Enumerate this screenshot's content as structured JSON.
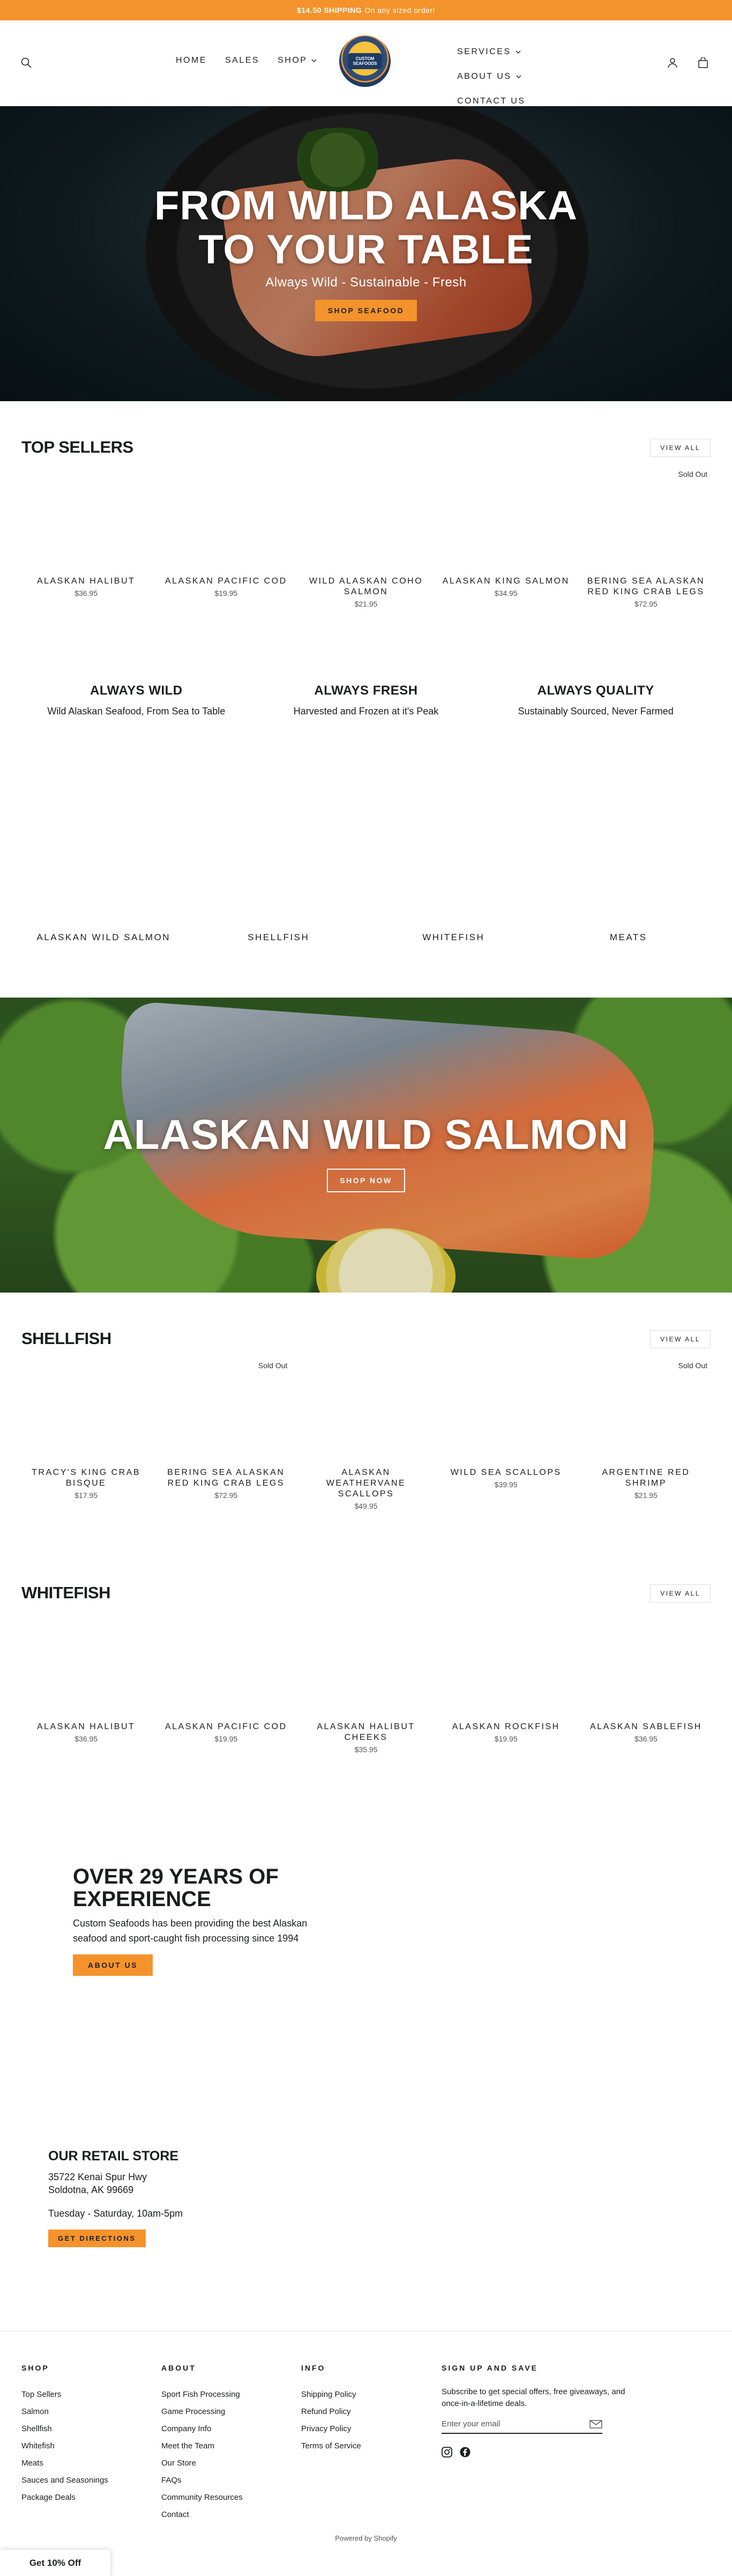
{
  "announcement": {
    "bold": "$14.50 SHIPPING",
    "rest": "On any sized order!"
  },
  "header": {
    "logo_text": "CUSTOM SEAFOODS",
    "nav_left": [
      {
        "label": "HOME"
      },
      {
        "label": "SALES"
      },
      {
        "label": "SHOP",
        "chevron": true
      }
    ],
    "nav_right": [
      {
        "label": "SERVICES",
        "chevron": true
      },
      {
        "label": "ABOUT US",
        "chevron": true
      },
      {
        "label": "CONTACT US"
      }
    ]
  },
  "hero": {
    "title": "FROM WILD ALASKA\nTO YOUR TABLE",
    "subtitle": "Always Wild - Sustainable - Fresh",
    "button": "SHOP SEAFOOD"
  },
  "top_sellers": {
    "title": "TOP SELLERS",
    "view_all": "VIEW ALL",
    "products": [
      {
        "name": "ALASKAN HALIBUT",
        "price": "$36.95",
        "sold_out": ""
      },
      {
        "name": "ALASKAN PACIFIC COD",
        "price": "$19.95",
        "sold_out": ""
      },
      {
        "name": "WILD ALASKAN COHO SALMON",
        "price": "$21.95",
        "sold_out": ""
      },
      {
        "name": "ALASKAN KING SALMON",
        "price": "$34.95",
        "sold_out": ""
      },
      {
        "name": "BERING SEA ALASKAN RED KING CRAB LEGS",
        "price": "$72.95",
        "sold_out": "Sold Out"
      }
    ]
  },
  "pillars": [
    {
      "title": "ALWAYS WILD",
      "text": "Wild Alaskan Seafood, From Sea to Table"
    },
    {
      "title": "ALWAYS FRESH",
      "text": "Harvested and Frozen at it's Peak"
    },
    {
      "title": "ALWAYS QUALITY",
      "text": "Sustainably Sourced, Never Farmed"
    }
  ],
  "categories": [
    {
      "label": "ALASKAN WILD SALMON"
    },
    {
      "label": "SHELLFISH"
    },
    {
      "label": "WHITEFISH"
    },
    {
      "label": "MEATS"
    }
  ],
  "banner": {
    "title": "ALASKAN WILD SALMON",
    "button": "SHOP NOW"
  },
  "shellfish": {
    "title": "SHELLFISH",
    "view_all": "VIEW ALL",
    "products": [
      {
        "name": "TRACY'S KING CRAB BISQUE",
        "price": "$17.95",
        "sold_out": ""
      },
      {
        "name": "BERING SEA ALASKAN RED KING CRAB LEGS",
        "price": "$72.95",
        "sold_out": "Sold Out"
      },
      {
        "name": "ALASKAN WEATHERVANE SCALLOPS",
        "price": "$49.95",
        "sold_out": ""
      },
      {
        "name": "WILD SEA SCALLOPS",
        "price": "$39.95",
        "sold_out": ""
      },
      {
        "name": "ARGENTINE RED SHRIMP",
        "price": "$21.95",
        "sold_out": "Sold Out"
      }
    ]
  },
  "whitefish": {
    "title": "WHITEFISH",
    "view_all": "VIEW ALL",
    "products": [
      {
        "name": "ALASKAN HALIBUT",
        "price": "$36.95",
        "sold_out": ""
      },
      {
        "name": "ALASKAN PACIFIC COD",
        "price": "$19.95",
        "sold_out": ""
      },
      {
        "name": "ALASKAN HALIBUT CHEEKS",
        "price": "$35.95",
        "sold_out": ""
      },
      {
        "name": "ALASKAN ROCKFISH",
        "price": "$19.95",
        "sold_out": ""
      },
      {
        "name": "ALASKAN SABLEFISH",
        "price": "$36.95",
        "sold_out": ""
      }
    ]
  },
  "about": {
    "title": "OVER 29 YEARS OF EXPERIENCE",
    "text": "Custom Seafoods has been providing the best Alaskan seafood and sport-caught fish processing since 1994",
    "button": "ABOUT US"
  },
  "store": {
    "title": "OUR RETAIL STORE",
    "address1": "35722 Kenai Spur Hwy",
    "address2": "Soldotna, AK 99669",
    "hours": "Tuesday - Saturday, 10am-5pm",
    "button": "GET DIRECTIONS"
  },
  "footer": {
    "shop": {
      "heading": "SHOP",
      "links": [
        "Top Sellers",
        "Salmon",
        "Shellfish",
        "Whitefish",
        "Meats",
        "Sauces and Seasonings",
        "Package Deals"
      ]
    },
    "about": {
      "heading": "ABOUT",
      "links": [
        "Sport Fish Processing",
        "Game Processing",
        "Company Info",
        "Meet the Team",
        "Our Store",
        "FAQs",
        "Community Resources",
        "Contact"
      ]
    },
    "info": {
      "heading": "INFO",
      "links": [
        "Shipping Policy",
        "Refund Policy",
        "Privacy Policy",
        "Terms of Service"
      ]
    },
    "newsletter": {
      "heading": "SIGN UP AND SAVE",
      "text": "Subscribe to get special offers, free giveaways, and once-in-a-lifetime deals.",
      "placeholder": "Enter your email"
    },
    "powered": "Powered by Shopify"
  },
  "discount_tab": "Get 10% Off",
  "colors": {
    "accent": "#f4932b",
    "text": "#1c1d1d"
  }
}
